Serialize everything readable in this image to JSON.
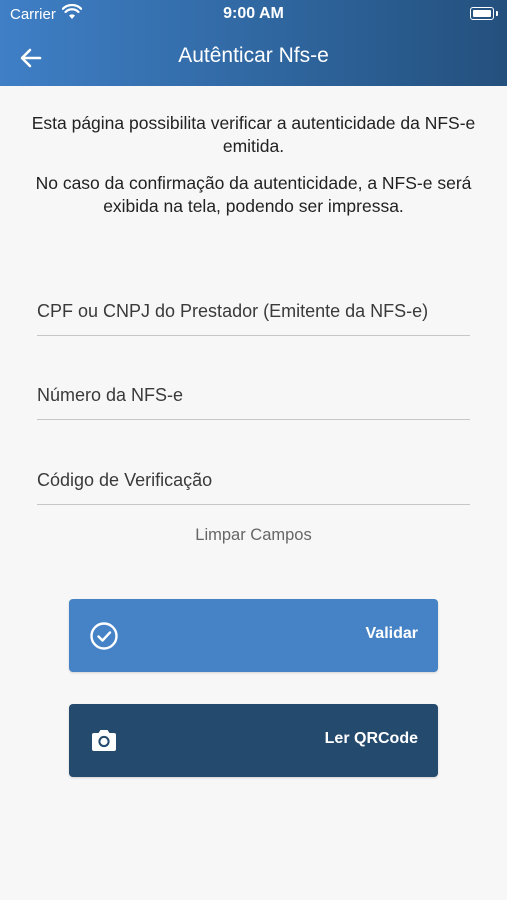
{
  "status_bar": {
    "carrier": "Carrier",
    "time": "9:00 AM"
  },
  "nav": {
    "title": "Autênticar Nfs-e",
    "back_icon": "arrow-left-icon"
  },
  "intro": {
    "line1": "Esta página possibilita verificar a autenticidade da NFS-e emitida.",
    "line2": "No caso da confirmação da autenticidade, a NFS-e será exibida na tela, podendo ser impressa."
  },
  "form": {
    "cpf_cnpj_placeholder": "CPF ou CNPJ do Prestador (Emitente da NFS-e)",
    "numero_placeholder": "Número da NFS-e",
    "codigo_placeholder": "Código de Verificação",
    "clear_label": "Limpar Campos"
  },
  "buttons": {
    "validate_label": "Validar",
    "validate_icon": "check-circle-icon",
    "qr_label": "Ler QRCode",
    "qr_icon": "camera-icon"
  },
  "colors": {
    "header_start": "#3f7fc6",
    "header_end": "#24507d",
    "validate_button": "#4683c6",
    "qr_button": "#244a6d",
    "background": "#f7f7f7"
  }
}
